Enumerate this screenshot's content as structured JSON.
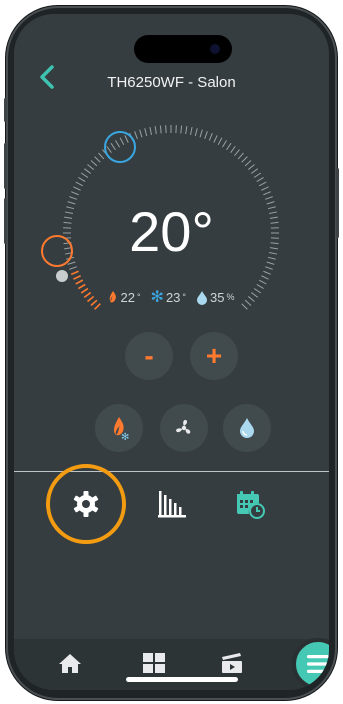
{
  "header": {
    "back_icon": "chevron-left-icon",
    "title": "TH6250WF - Salon"
  },
  "thermostat": {
    "setpoint": "20°",
    "setpoint_value": 20,
    "stats": {
      "heat": {
        "icon": "flame-icon",
        "value": "22",
        "unit": "°"
      },
      "cool": {
        "icon": "snowflake-icon",
        "value": "23",
        "unit": "°"
      },
      "humidity": {
        "icon": "droplet-icon",
        "value": "35",
        "unit": "%"
      }
    },
    "minus_label": "-",
    "plus_label": "+"
  },
  "modes": [
    {
      "icon": "heat-mode-icon"
    },
    {
      "icon": "fan-mode-icon"
    },
    {
      "icon": "humidity-mode-icon"
    }
  ],
  "tabs": [
    {
      "icon": "gear-icon",
      "highlighted": true
    },
    {
      "icon": "bar-chart-icon"
    },
    {
      "icon": "calendar-clock-icon"
    }
  ],
  "bottom_nav": [
    {
      "icon": "home-icon"
    },
    {
      "icon": "grid-icon"
    },
    {
      "icon": "clapperboard-icon"
    },
    {
      "icon": "menu-icon"
    }
  ],
  "colors": {
    "accent_teal": "#45c9b4",
    "heat_orange": "#ff7a2f",
    "cool_blue": "#3aa6e0",
    "highlight": "#f39c12",
    "background": "#353d40"
  }
}
